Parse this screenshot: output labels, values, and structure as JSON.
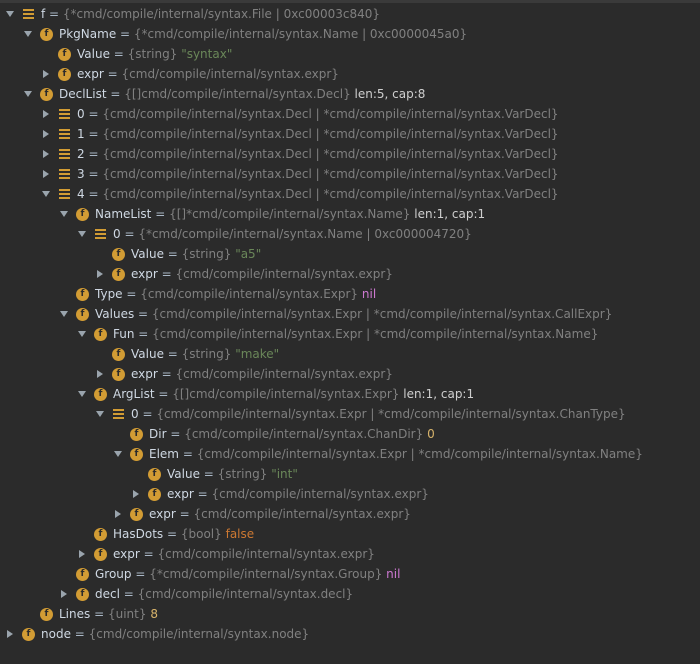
{
  "colors": {
    "background": "#2b2b2b",
    "field_icon": "#d29c34",
    "string_value": "#6a8759",
    "number_value": "#d7b36b"
  },
  "rows": [
    {
      "name": "f",
      "type": "{*cmd/compile/internal/syntax.File | 0xc00003c840}",
      "value": "",
      "icon": "list-icon",
      "toggle": "expanded"
    },
    {
      "name": "PkgName",
      "type": "{*cmd/compile/internal/syntax.Name | 0xc0000045a0}",
      "value": "",
      "icon": "field-icon",
      "toggle": "expanded"
    },
    {
      "name": "Value",
      "type": "{string}",
      "value": "\"syntax\"",
      "icon": "field-icon",
      "toggle": "none",
      "value_kind": "str"
    },
    {
      "name": "expr",
      "type": "{cmd/compile/internal/syntax.expr}",
      "value": "",
      "icon": "field-icon",
      "toggle": "collapsed"
    },
    {
      "name": "DeclList",
      "type": "{[]cmd/compile/internal/syntax.Decl}",
      "value": "len:5, cap:8",
      "icon": "field-icon",
      "toggle": "expanded"
    },
    {
      "name": "0",
      "type": "{cmd/compile/internal/syntax.Decl | *cmd/compile/internal/syntax.VarDecl}",
      "value": "",
      "icon": "list-icon",
      "toggle": "collapsed"
    },
    {
      "name": "1",
      "type": "{cmd/compile/internal/syntax.Decl | *cmd/compile/internal/syntax.VarDecl}",
      "value": "",
      "icon": "list-icon",
      "toggle": "collapsed"
    },
    {
      "name": "2",
      "type": "{cmd/compile/internal/syntax.Decl | *cmd/compile/internal/syntax.VarDecl}",
      "value": "",
      "icon": "list-icon",
      "toggle": "collapsed"
    },
    {
      "name": "3",
      "type": "{cmd/compile/internal/syntax.Decl | *cmd/compile/internal/syntax.VarDecl}",
      "value": "",
      "icon": "list-icon",
      "toggle": "collapsed"
    },
    {
      "name": "4",
      "type": "{cmd/compile/internal/syntax.Decl | *cmd/compile/internal/syntax.VarDecl}",
      "value": "",
      "icon": "list-icon",
      "toggle": "expanded"
    },
    {
      "name": "NameList",
      "type": "{[]*cmd/compile/internal/syntax.Name}",
      "value": "len:1, cap:1",
      "icon": "field-icon",
      "toggle": "expanded"
    },
    {
      "name": "0",
      "type": "{*cmd/compile/internal/syntax.Name | 0xc000004720}",
      "value": "",
      "icon": "list-icon",
      "toggle": "expanded"
    },
    {
      "name": "Value",
      "type": "{string}",
      "value": "\"a5\"",
      "icon": "field-icon",
      "toggle": "none",
      "value_kind": "str"
    },
    {
      "name": "expr",
      "type": "{cmd/compile/internal/syntax.expr}",
      "value": "",
      "icon": "field-icon",
      "toggle": "collapsed"
    },
    {
      "name": "Type",
      "type": "{cmd/compile/internal/syntax.Expr}",
      "value": "nil",
      "icon": "field-icon",
      "toggle": "none",
      "value_kind": "nil"
    },
    {
      "name": "Values",
      "type": "{cmd/compile/internal/syntax.Expr | *cmd/compile/internal/syntax.CallExpr}",
      "value": "",
      "icon": "field-icon",
      "toggle": "expanded"
    },
    {
      "name": "Fun",
      "type": "{cmd/compile/internal/syntax.Expr | *cmd/compile/internal/syntax.Name}",
      "value": "",
      "icon": "field-icon",
      "toggle": "expanded"
    },
    {
      "name": "Value",
      "type": "{string}",
      "value": "\"make\"",
      "icon": "field-icon",
      "toggle": "none",
      "value_kind": "str"
    },
    {
      "name": "expr",
      "type": "{cmd/compile/internal/syntax.expr}",
      "value": "",
      "icon": "field-icon",
      "toggle": "collapsed"
    },
    {
      "name": "ArgList",
      "type": "{[]cmd/compile/internal/syntax.Expr}",
      "value": "len:1, cap:1",
      "icon": "field-icon",
      "toggle": "expanded"
    },
    {
      "name": "0",
      "type": "{cmd/compile/internal/syntax.Expr | *cmd/compile/internal/syntax.ChanType}",
      "value": "",
      "icon": "list-icon",
      "toggle": "expanded"
    },
    {
      "name": "Dir",
      "type": "{cmd/compile/internal/syntax.ChanDir}",
      "value": "0",
      "icon": "field-icon",
      "toggle": "none",
      "value_kind": "num"
    },
    {
      "name": "Elem",
      "type": "{cmd/compile/internal/syntax.Expr | *cmd/compile/internal/syntax.Name}",
      "value": "",
      "icon": "field-icon",
      "toggle": "expanded"
    },
    {
      "name": "Value",
      "type": "{string}",
      "value": "\"int\"",
      "icon": "field-icon",
      "toggle": "none",
      "value_kind": "str"
    },
    {
      "name": "expr",
      "type": "{cmd/compile/internal/syntax.expr}",
      "value": "",
      "icon": "field-icon",
      "toggle": "collapsed"
    },
    {
      "name": "expr",
      "type": "{cmd/compile/internal/syntax.expr}",
      "value": "",
      "icon": "field-icon",
      "toggle": "collapsed"
    },
    {
      "name": "HasDots",
      "type": "{bool}",
      "value": "false",
      "icon": "field-icon",
      "toggle": "none",
      "value_kind": "bool"
    },
    {
      "name": "expr",
      "type": "{cmd/compile/internal/syntax.expr}",
      "value": "",
      "icon": "field-icon",
      "toggle": "collapsed"
    },
    {
      "name": "Group",
      "type": "{*cmd/compile/internal/syntax.Group}",
      "value": "nil",
      "icon": "field-icon",
      "toggle": "none",
      "value_kind": "nil"
    },
    {
      "name": "decl",
      "type": "{cmd/compile/internal/syntax.decl}",
      "value": "",
      "icon": "field-icon",
      "toggle": "collapsed"
    },
    {
      "name": "Lines",
      "type": "{uint}",
      "value": "8",
      "icon": "field-icon",
      "toggle": "none",
      "value_kind": "num"
    },
    {
      "name": "node",
      "type": "{cmd/compile/internal/syntax.node}",
      "value": "",
      "icon": "field-icon",
      "toggle": "collapsed"
    }
  ]
}
